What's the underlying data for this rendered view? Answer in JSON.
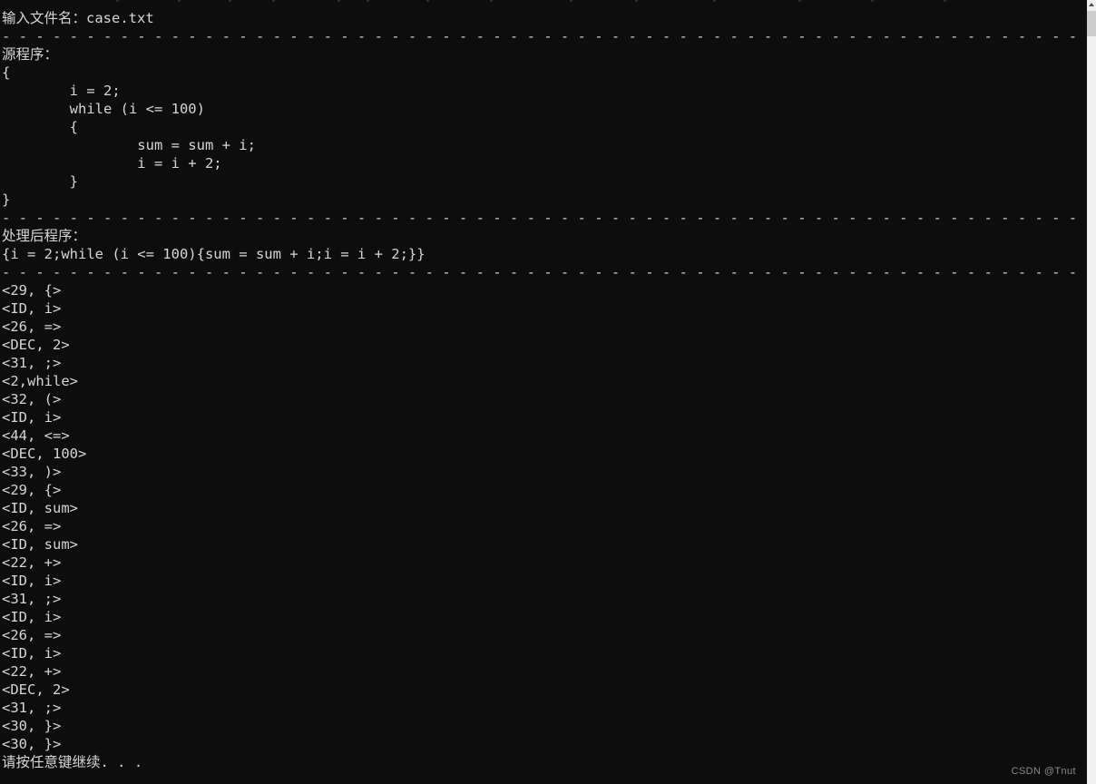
{
  "window": {
    "title": "console-output",
    "background_color": "#0d0d0d",
    "text_color": "#d6d6d6"
  },
  "scrollbar": {
    "orientation": "vertical",
    "up_arrow": "▲",
    "thumb_position": "top"
  },
  "watermark": {
    "text": "CSDN @Tnut"
  },
  "console": {
    "lines": [
      {
        "id": "prompt-filename",
        "text": "输入文件名：case.txt"
      },
      {
        "id": "separator-1",
        "text": "- - - - - - - - - - - - - - - - - - - - - - - - - - - - - - - - - - - - - - - - - - - - - - - - - - - - - - - - - - - - - - - - - - - - - - - - - - - - - - - - - - - - - - - - - - - - - - - - - - - - - - - - - - -"
      },
      {
        "id": "label-source-program",
        "text": "源程序："
      },
      {
        "id": "src-open-brace",
        "text": "{"
      },
      {
        "id": "src-assign-i",
        "text": "        i = 2;"
      },
      {
        "id": "src-while",
        "text": "        while (i <= 100)"
      },
      {
        "id": "src-inner-open",
        "text": "        {"
      },
      {
        "id": "src-sum",
        "text": "                sum = sum + i;"
      },
      {
        "id": "src-incr-i",
        "text": "                i = i + 2;"
      },
      {
        "id": "src-inner-close",
        "text": "        }"
      },
      {
        "id": "src-close-brace",
        "text": "}"
      },
      {
        "id": "separator-2",
        "text": "- - - - - - - - - - - - - - - - - - - - - - - - - - - - - - - - - - - - - - - - - - - - - - - - - - - - - - - - - - - - - - - - - - - - - - - - - - - - - - - - - - - - - - - - - - - - - - - - - - - - - - - - - - -"
      },
      {
        "id": "label-processed-program",
        "text": "处理后程序："
      },
      {
        "id": "processed-program",
        "text": "{i = 2;while (i <= 100){sum = sum + i;i = i + 2;}}"
      },
      {
        "id": "separator-3",
        "text": "- - - - - - - - - - - - - - - - - - - - - - - - - - - - - - - - - - - - - - - - - - - - - - - - - - - - - - - - - - - - - - - - - - - - - - - - - - - - - - - - - - - - - - - - - - - - - - - - - - - - - - - - - - -"
      },
      {
        "id": "token-01",
        "text": "<29, {>"
      },
      {
        "id": "token-02",
        "text": "<ID, i>"
      },
      {
        "id": "token-03",
        "text": "<26, =>"
      },
      {
        "id": "token-04",
        "text": "<DEC, 2>"
      },
      {
        "id": "token-05",
        "text": "<31, ;>"
      },
      {
        "id": "token-06",
        "text": "<2,while>"
      },
      {
        "id": "token-07",
        "text": "<32, (>"
      },
      {
        "id": "token-08",
        "text": "<ID, i>"
      },
      {
        "id": "token-09",
        "text": "<44, <=>"
      },
      {
        "id": "token-10",
        "text": "<DEC, 100>"
      },
      {
        "id": "token-11",
        "text": "<33, )>"
      },
      {
        "id": "token-12",
        "text": "<29, {>"
      },
      {
        "id": "token-13",
        "text": "<ID, sum>"
      },
      {
        "id": "token-14",
        "text": "<26, =>"
      },
      {
        "id": "token-15",
        "text": "<ID, sum>"
      },
      {
        "id": "token-16",
        "text": "<22, +>"
      },
      {
        "id": "token-17",
        "text": "<ID, i>"
      },
      {
        "id": "token-18",
        "text": "<31, ;>"
      },
      {
        "id": "token-19",
        "text": "<ID, i>"
      },
      {
        "id": "token-20",
        "text": "<26, =>"
      },
      {
        "id": "token-21",
        "text": "<ID, i>"
      },
      {
        "id": "token-22",
        "text": "<22, +>"
      },
      {
        "id": "token-23",
        "text": "<DEC, 2>"
      },
      {
        "id": "token-24",
        "text": "<31, ;>"
      },
      {
        "id": "token-25",
        "text": "<30, }>"
      },
      {
        "id": "token-26",
        "text": "<30, }>"
      },
      {
        "id": "press-any-key",
        "text": "请按任意键继续. . ."
      }
    ]
  }
}
